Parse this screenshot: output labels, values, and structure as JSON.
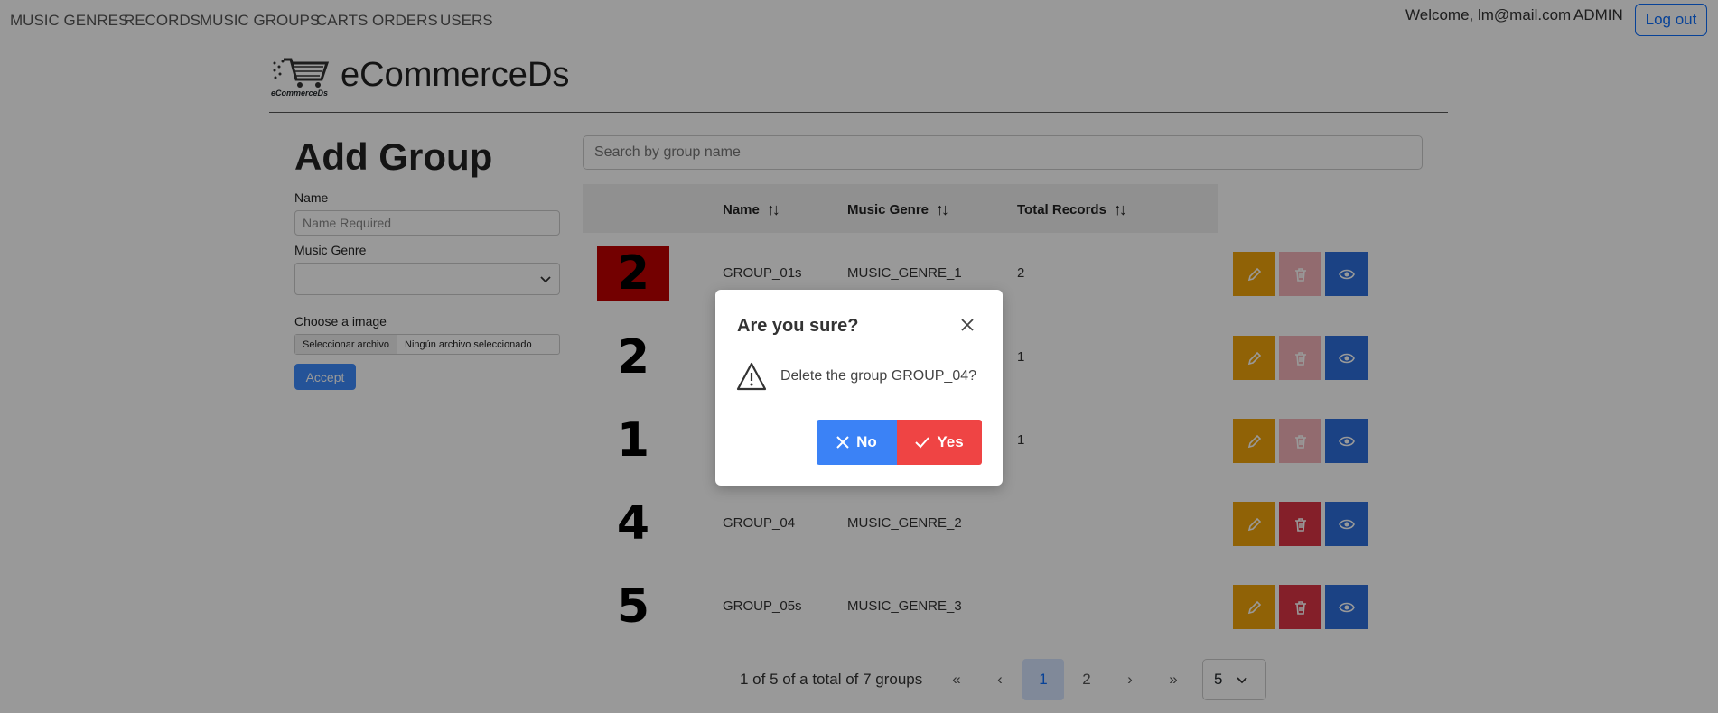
{
  "nav": {
    "links": [
      "MUSIC GENRES",
      "RECORDS",
      "MUSIC GROUPS",
      "CARTS",
      "ORDERS",
      "USERS"
    ],
    "welcome": "Welcome, lm@mail.com",
    "role": "ADMIN",
    "logout_label": "Log out"
  },
  "brand": {
    "title": "eCommerceDs",
    "logo_text": "eCommerceDs"
  },
  "form": {
    "heading": "Add Group",
    "name_label": "Name",
    "name_placeholder": "Name Required",
    "genre_label": "Music Genre",
    "genre_value": "",
    "image_label": "Choose a image",
    "file_button": "Seleccionar archivo",
    "file_status": "Ningún archivo seleccionado",
    "accept_label": "Accept"
  },
  "search": {
    "placeholder": "Search by group name"
  },
  "table": {
    "columns": [
      "Name",
      "Music Genre",
      "Total Records"
    ],
    "rows": [
      {
        "image_text": "2",
        "name": "GROUP_01s",
        "genre": "MUSIC_GENRE_1",
        "total": "2",
        "delete_enabled": false,
        "image_bg": "#c00000"
      },
      {
        "image_text": "2",
        "name": "",
        "genre": "",
        "total": "1",
        "delete_enabled": false,
        "image_bg": ""
      },
      {
        "image_text": "1",
        "name": "",
        "genre": "",
        "total": "1",
        "delete_enabled": false,
        "image_bg": ""
      },
      {
        "image_text": "4",
        "name": "GROUP_04",
        "genre": "MUSIC_GENRE_2",
        "total": "",
        "delete_enabled": true,
        "image_bg": ""
      },
      {
        "image_text": "5",
        "name": "GROUP_05s",
        "genre": "MUSIC_GENRE_3",
        "total": "",
        "delete_enabled": true,
        "image_bg": ""
      }
    ]
  },
  "pagination": {
    "info": "1 of 5 of a total of 7 groups",
    "first": "«",
    "prev": "‹",
    "pages": [
      "1",
      "2"
    ],
    "current_page": "1",
    "next": "›",
    "last": "»",
    "rows_per_page": "5"
  },
  "modal": {
    "title": "Are you sure?",
    "message": "Delete the group GROUP_04?",
    "no_label": "No",
    "yes_label": "Yes"
  },
  "colors": {
    "edit": "#f0a30a",
    "delete": "#dc3545",
    "view": "#2d6fdc",
    "no_button": "#3b82f6",
    "yes_button": "#ef4444"
  }
}
